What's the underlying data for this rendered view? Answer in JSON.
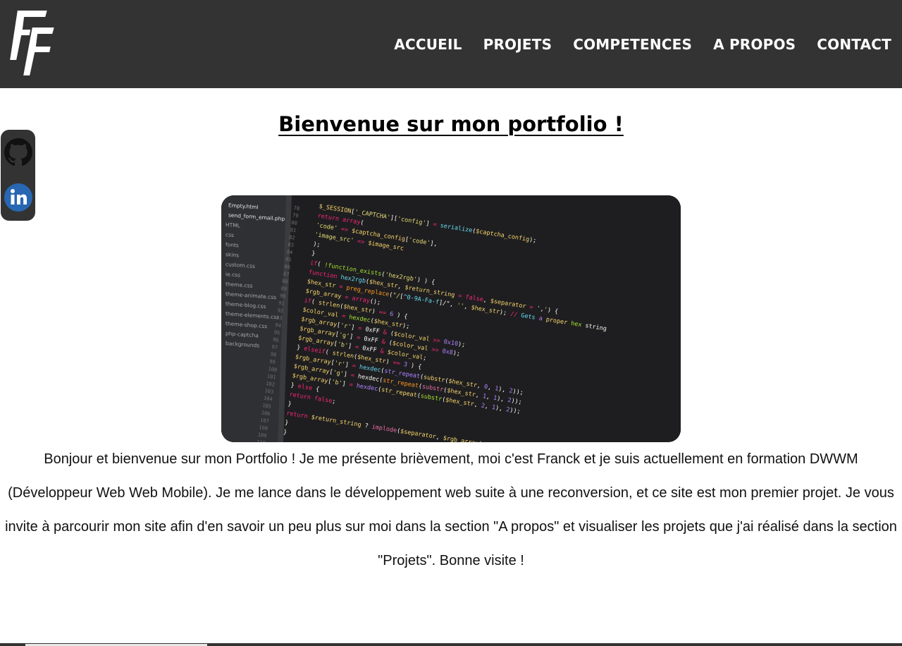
{
  "header": {
    "logo_text": "FF",
    "nav": [
      {
        "label": "ACCUEIL"
      },
      {
        "label": "PROJETS"
      },
      {
        "label": "COMPETENCES"
      },
      {
        "label": "A PROPOS"
      },
      {
        "label": "CONTACT"
      }
    ]
  },
  "main": {
    "title": "Bienvenue sur mon portfolio !",
    "hero_image": {
      "sidebar_files": [
        "Empty.html",
        "send_form_email.php",
        "HTML",
        "css",
        "fonts",
        "skins",
        "custom.css",
        "ie.css",
        "theme.css",
        "theme-animate.css",
        "theme-blog.css",
        "theme-elements.css",
        "theme-shop.css",
        "php-captcha",
        "backgrounds"
      ],
      "line_numbers": [
        "78",
        "79",
        "80",
        "81",
        "82",
        "83",
        "84",
        "85",
        "86",
        "87",
        "88",
        "89",
        "90",
        "91",
        "92",
        "93",
        "94",
        "95",
        "96",
        "97",
        "98",
        "99",
        "100",
        "101",
        "102",
        "103",
        "104",
        "105",
        "106",
        "107",
        "108",
        "109",
        "110"
      ],
      "code_lines": [
        "$_SESSION['_CAPTCHA']['config'] = serialize($captcha_config);",
        "return array(",
        "  'code' => $captcha_config['code'],",
        "  'image_src' => $image_src",
        ");",
        "}",
        "if( !function_exists('hex2rgb') ) {",
        "  function hex2rgb($hex_str, $return_string = false, $separator = ',') {",
        "    $hex_str = preg_replace(\"/[^0-9A-Fa-f]/\", '', $hex_str); // Gets a proper hex string",
        "    $rgb_array = array();",
        "    if( strlen($hex_str) == 6 ) {",
        "      $color_val = hexdec($hex_str);",
        "      $rgb_array['r'] = 0xFF & ($color_val >> 0x10);",
        "      $rgb_array['g'] = 0xFF & ($color_val >> 0x8);",
        "      $rgb_array['b'] = 0xFF & $color_val;",
        "    } elseif( strlen($hex_str) == 3 ) {",
        "      $rgb_array['r'] = hexdec(str_repeat(substr($hex_str, 0, 1), 2));",
        "      $rgb_array['g'] = hexdec(str_repeat(substr($hex_str, 1, 1), 2));",
        "      $rgb_array['b'] = hexdec(str_repeat(substr($hex_str, 2, 1), 2));",
        "    } else {",
        "      return false;",
        "    }",
        "    return $return_string ? implode($separator, $rgb_array) : $rgb_array;",
        "  }",
        "}"
      ]
    },
    "intro_text": "Bonjour et bienvenue sur mon Portfolio ! Je me présente brièvement, moi c'est Franck et je suis actuellement en formation DWWM (Développeur Web Web Mobile). Je me lance dans le développement web suite à une reconversion, et ce site est mon premier projet. Je vous invite à parcourir mon site afin d'en savoir un peu plus sur moi dans la section \"A propos\" et visualiser les projets que j'ai réalisé dans la section \"Projets\". Bonne visite !"
  },
  "social": [
    {
      "icon": "github-icon"
    },
    {
      "icon": "linkedin-icon"
    }
  ],
  "colors": {
    "header_bg": "#333333",
    "nav_text": "#ffffff",
    "linkedin_blue": "#2867b2"
  }
}
